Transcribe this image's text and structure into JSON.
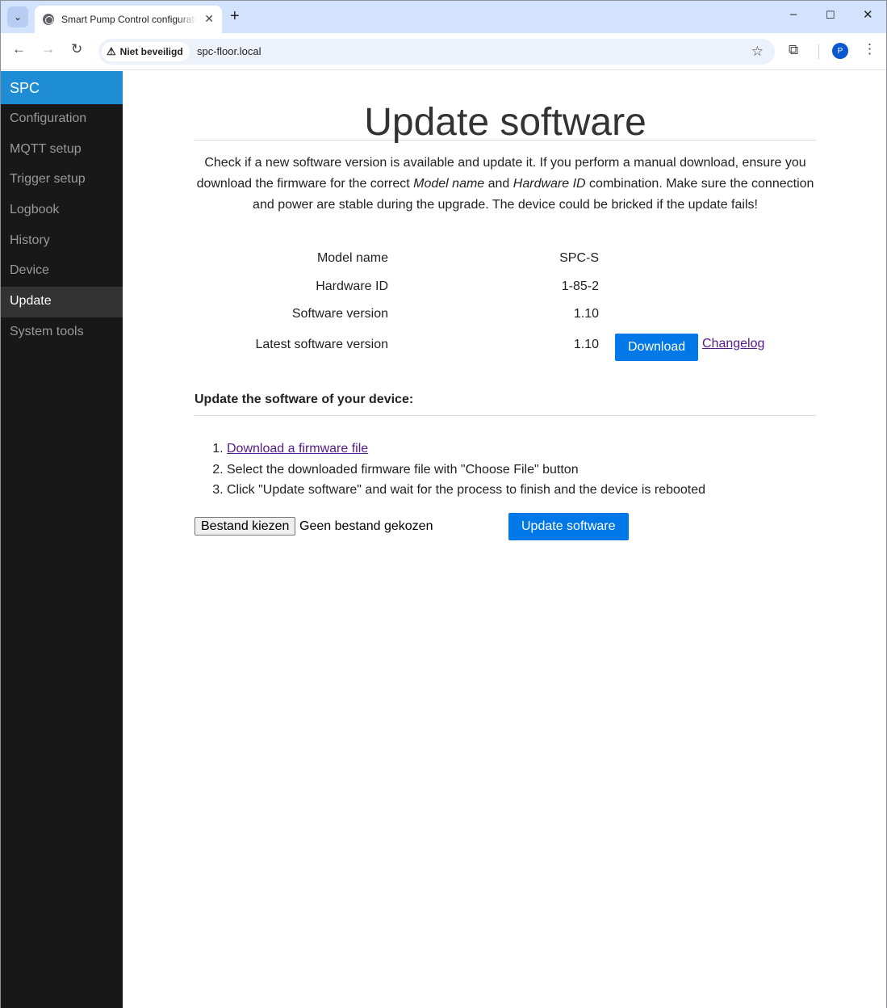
{
  "browser": {
    "tab_title": "Smart Pump Control configuration",
    "security_label": "Niet beveiligd",
    "url": "spc-floor.local",
    "profile_initial": "P"
  },
  "sidebar": {
    "brand": "SPC",
    "items": [
      {
        "label": "Configuration"
      },
      {
        "label": "MQTT setup"
      },
      {
        "label": "Trigger setup"
      },
      {
        "label": "Logbook"
      },
      {
        "label": "History"
      },
      {
        "label": "Device"
      },
      {
        "label": "Update",
        "active": true
      },
      {
        "label": "System tools"
      }
    ]
  },
  "main": {
    "title": "Update software",
    "intro_part1": "Check if a new software version is available and update it. If you perform a manual download, ensure you download the firmware for the correct ",
    "intro_em1": "Model name",
    "intro_part2": " and ",
    "intro_em2": "Hardware ID",
    "intro_part3": " combination. Make sure the connection and power are stable during the upgrade. The device could be bricked if the update fails!",
    "info": {
      "model_label": "Model name",
      "model_value": "SPC-S",
      "hw_label": "Hardware ID",
      "hw_value": "1-85-2",
      "sw_label": "Software version",
      "sw_value": "1.10",
      "latest_label": "Latest software version",
      "latest_value": "1.10",
      "download_label": "Download",
      "changelog_label": "Changelog"
    },
    "section_title": "Update the software of your device:",
    "steps": {
      "step1_link": "Download a firmware file",
      "step2": "Select the downloaded firmware file with \"Choose File\" button",
      "step3": "Click \"Update software\" and wait for the process to finish and the device is rebooted"
    },
    "file_button": "Bestand kiezen",
    "file_status": "Geen bestand gekozen",
    "update_button": "Update software"
  },
  "colors": {
    "brand_blue": "#1f8dd6",
    "button_blue": "#0078e7",
    "sidebar_bg": "#191818"
  }
}
